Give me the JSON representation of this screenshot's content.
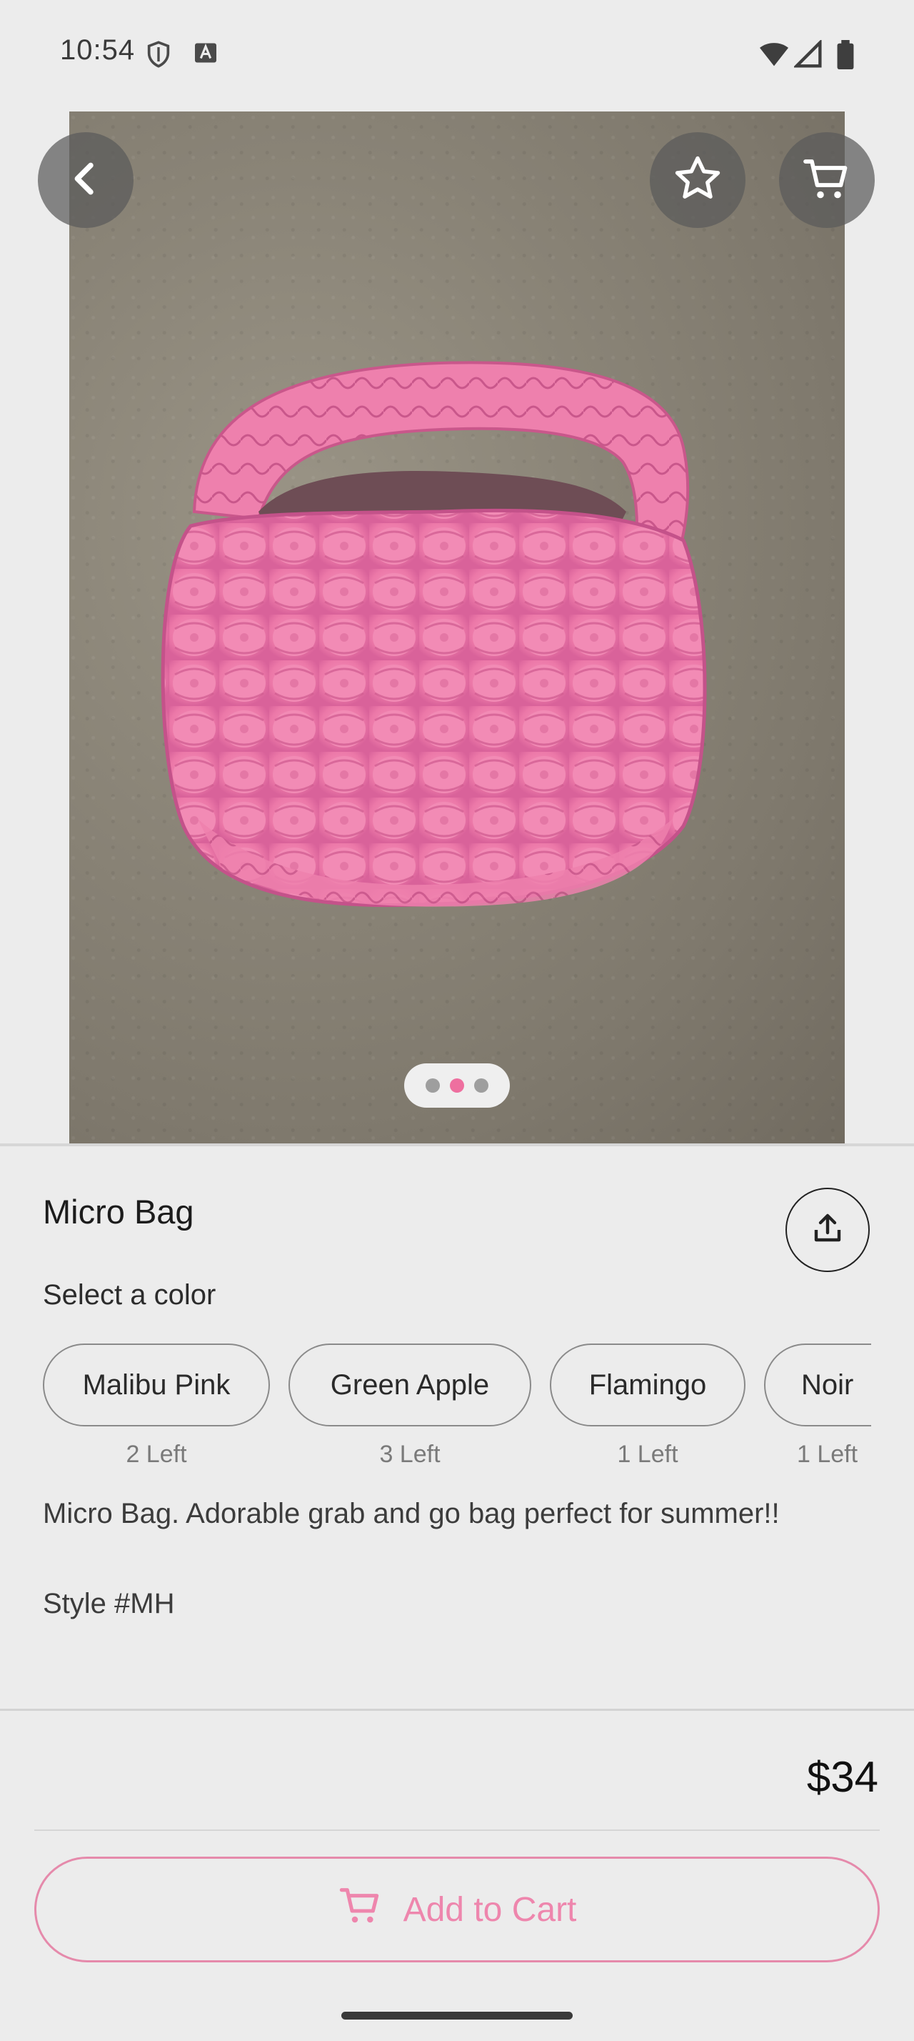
{
  "status_bar": {
    "time": "10:54"
  },
  "photo": {
    "alt": "Pink quilted micro bag on concrete floor",
    "page_count": 3,
    "active_index": 1,
    "colors": {
      "bag": "#ef7aa8",
      "dot_active": "#ee6f9f",
      "dot": "#9e9e9e"
    }
  },
  "product": {
    "title": "Micro Bag",
    "select_label": "Select a color",
    "colors": [
      {
        "name": "Malibu Pink",
        "stock": "2 Left"
      },
      {
        "name": "Green Apple",
        "stock": "3 Left"
      },
      {
        "name": "Flamingo",
        "stock": "1 Left"
      },
      {
        "name": "Noir",
        "stock": "1 Left"
      }
    ],
    "description": "Micro Bag. Adorable grab and go bag perfect for summer!!",
    "style": "Style #MH",
    "price": "$34"
  },
  "actions": {
    "add_to_cart": "Add to Cart",
    "accent_color": "#ee86ad"
  },
  "icons": {
    "back": "chevron-left-icon",
    "favorite": "star-icon",
    "cart": "cart-icon",
    "share": "share-icon"
  }
}
